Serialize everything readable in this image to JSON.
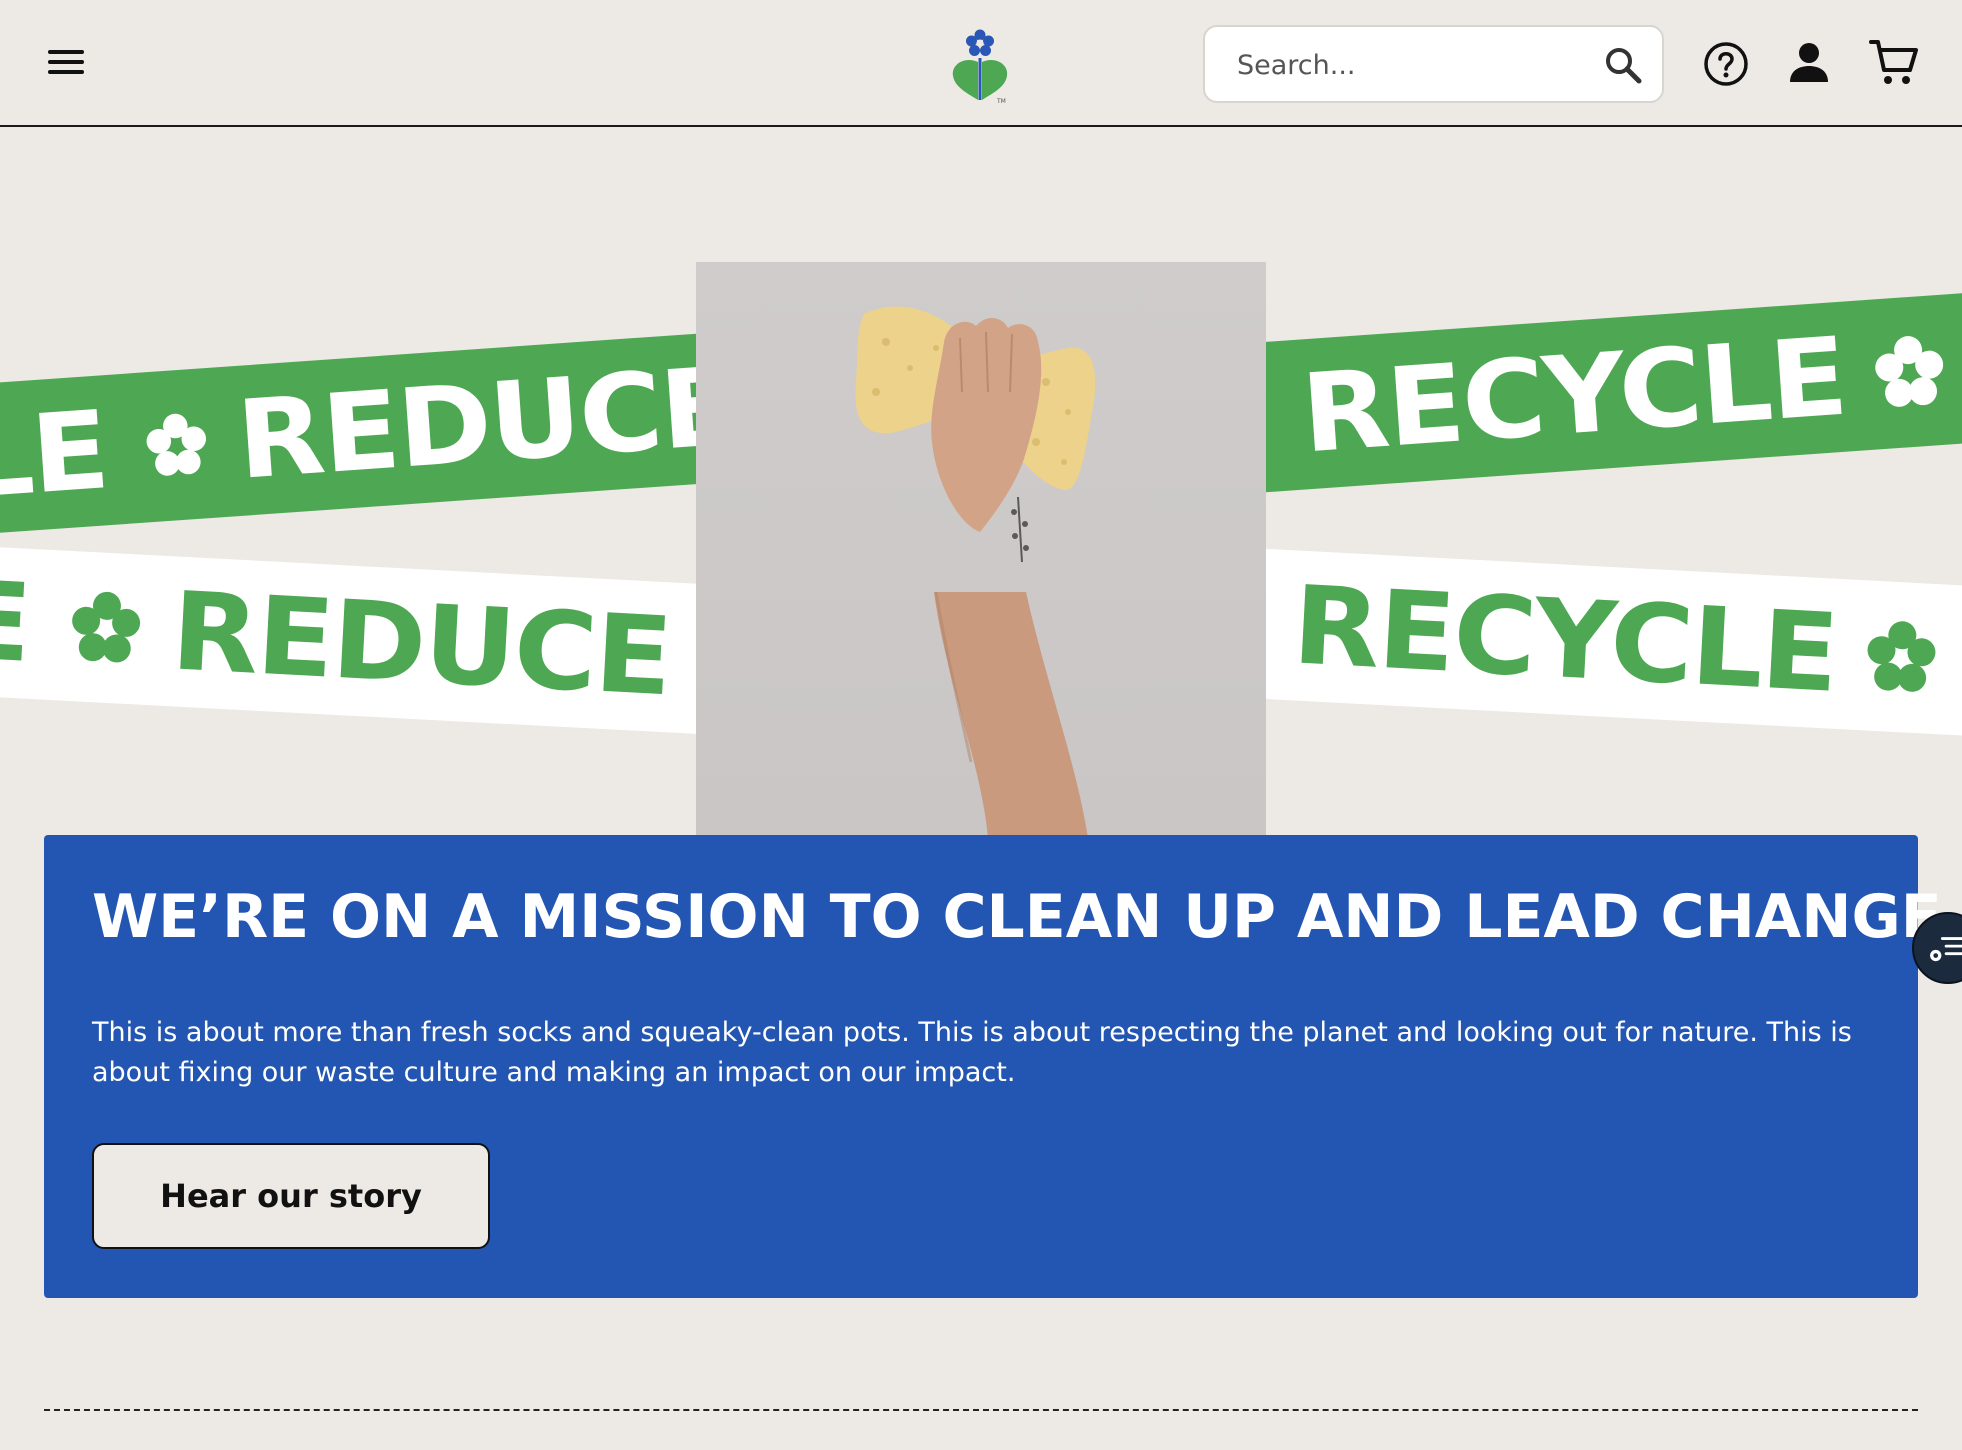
{
  "header": {
    "search_placeholder": "Search...",
    "icons": [
      "menu-icon",
      "logo",
      "search-icon",
      "help-icon",
      "user-icon",
      "cart-icon"
    ]
  },
  "hero": {
    "band_left_green": {
      "words": [
        "LE",
        "REDUCE"
      ]
    },
    "band_left_white": {
      "words": [
        "E",
        "REDUCE"
      ]
    },
    "band_right_green": {
      "words": [
        "RECYCLE"
      ]
    },
    "band_right_white": {
      "words": [
        "RECYCLE"
      ]
    },
    "photo_alt": "hand holding a sponge"
  },
  "mission": {
    "title": "WE’RE ON A MISSION TO CLEAN UP AND LEAD CHANGE",
    "body": "This is about more than fresh socks and squeaky-clean pots. This is about respecting the planet and looking out for nature. This is about fixing our waste culture and making an impact on our impact.",
    "cta": "Hear our story"
  },
  "colors": {
    "background": "#ede9e4",
    "green": "#4ea853",
    "blue": "#2356b2",
    "dark": "#111111"
  }
}
